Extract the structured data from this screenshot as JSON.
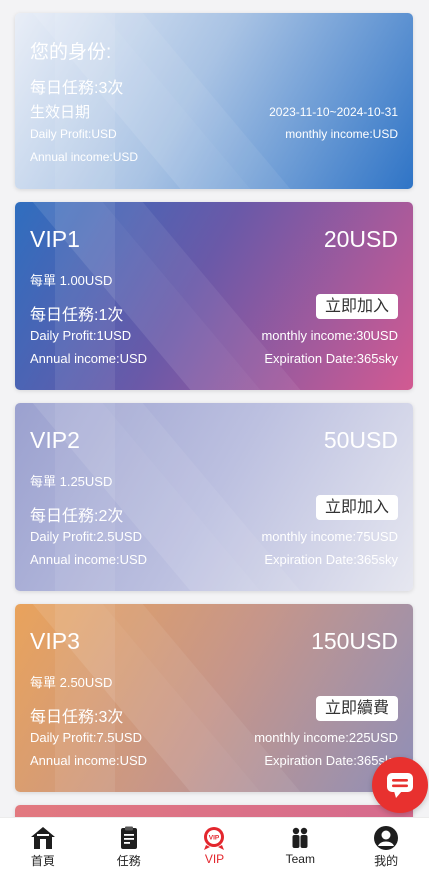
{
  "status": {
    "title": "您的身份:",
    "daily_tasks": "每日任務:3次",
    "effective_date_label": "生效日期",
    "date_range": "2023-11-10~2024-10-31",
    "daily_profit": "Daily Profit:USD",
    "monthly_income": "monthly income:USD",
    "annual_income": "Annual income:USD"
  },
  "vips": [
    {
      "name": "VIP1",
      "price": "20USD",
      "per_order": "每單 1.00USD",
      "tasks": "每日任務:1次",
      "button": "立即加入",
      "daily_profit": "Daily Profit:1USD",
      "monthly_income": "monthly income:30USD",
      "annual_income": "Annual income:USD",
      "expiration": "Expiration Date:365sky"
    },
    {
      "name": "VIP2",
      "price": "50USD",
      "per_order": "每單 1.25USD",
      "tasks": "每日任務:2次",
      "button": "立即加入",
      "daily_profit": "Daily Profit:2.5USD",
      "monthly_income": "monthly income:75USD",
      "annual_income": "Annual income:USD",
      "expiration": "Expiration Date:365sky"
    },
    {
      "name": "VIP3",
      "price": "150USD",
      "per_order": "每單 2.50USD",
      "tasks": "每日任務:3次",
      "button": "立即續費",
      "daily_profit": "Daily Profit:7.5USD",
      "monthly_income": "monthly income:225USD",
      "annual_income": "Annual income:USD",
      "expiration": "Expiration Date:365sky"
    }
  ],
  "nav": {
    "items": [
      {
        "label": "首頁",
        "icon": "home-icon"
      },
      {
        "label": "任務",
        "icon": "task-clipboard-icon"
      },
      {
        "label": "VIP",
        "icon": "vip-badge-icon"
      },
      {
        "label": "Team",
        "icon": "team-icon"
      },
      {
        "label": "我的",
        "icon": "profile-icon"
      }
    ],
    "active": "VIP"
  },
  "chat_button": {
    "icon": "chat-bubble-icon"
  },
  "colors": {
    "accent": "#e3262d",
    "chat": "#e8312f"
  }
}
